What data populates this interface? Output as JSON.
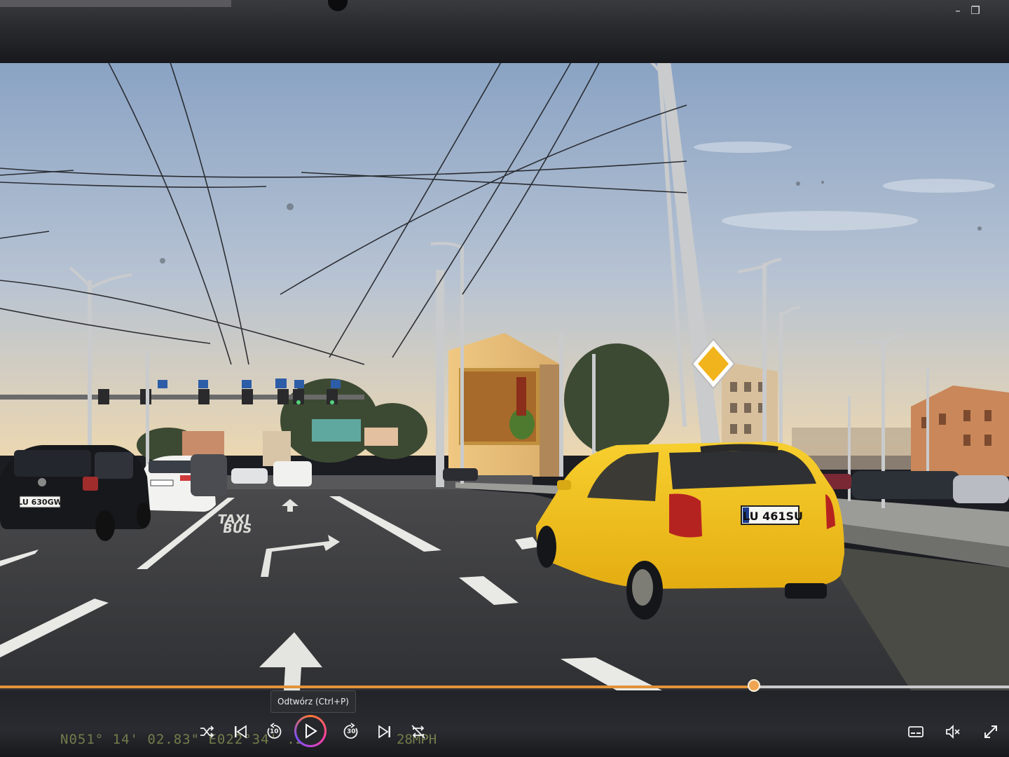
{
  "window": {
    "minimize_glyph": "–",
    "restore_glyph": "❐"
  },
  "video": {
    "plate_yellow_car": "LU 461SU",
    "plate_black_car": "LU 630GW",
    "road_text_line1": "TAXI",
    "road_text_line2": "BUS"
  },
  "overlay": {
    "gps_text": "N051° 14' 02.83\"  E022°34'  .22\"",
    "speed_text": "28MPH"
  },
  "player": {
    "progress": 0.747,
    "tooltip": "Odtwórz (Ctrl+P)",
    "skip_back_label": "10",
    "skip_forward_label": "30"
  },
  "icons": {
    "shuffle": "shuffle-icon",
    "previous": "previous-track-icon",
    "skip_back": "skip-back-10-icon",
    "play": "play-icon",
    "skip_forward": "skip-forward-30-icon",
    "next": "next-track-icon",
    "repeat_off": "repeat-off-icon",
    "captions": "captions-icon",
    "mute": "volume-muted-icon",
    "fullscreen": "fullscreen-icon"
  },
  "colors": {
    "accent": "#e2933a",
    "sky_top": "#93a9c6",
    "sky_bottom": "#e6d6b6",
    "yellow_car": "#f2c21c",
    "road": "#3c3d40"
  }
}
